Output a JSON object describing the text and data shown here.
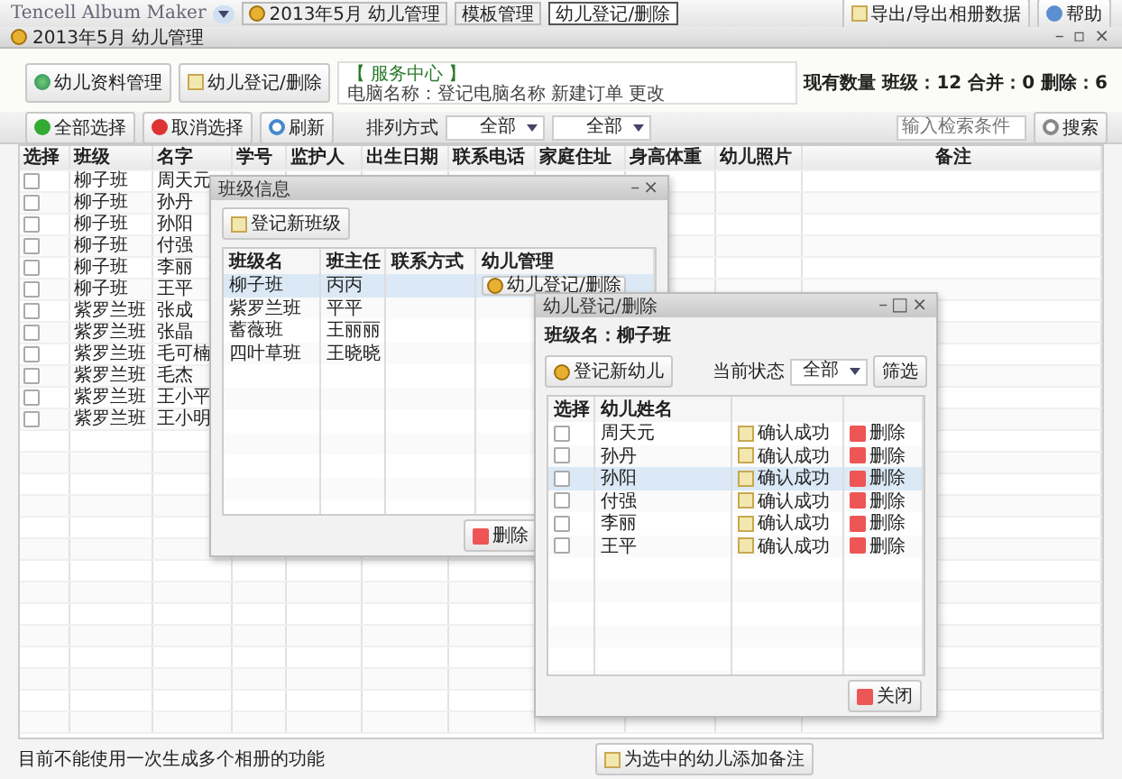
{
  "window": {
    "title": "Tencell Album Maker",
    "tabs": [
      {
        "label": "2013年5月 幼儿管理",
        "selected": false
      },
      {
        "label": "模板管理",
        "selected": false
      },
      {
        "label": "幼儿登记/删除",
        "selected": true
      }
    ],
    "export_button": "导出/导出相册数据",
    "help_button": "帮助",
    "subtitle": "2013年5月 幼儿管理",
    "controls": [
      "–",
      "▫",
      "×"
    ]
  },
  "toolbar": {
    "buttons": [
      "幼儿资料管理",
      "幼儿登记/删除"
    ],
    "info_title": "【 服务中心 】",
    "info_text": "电脑名称：登记电脑名称  新建订单  更改",
    "summary": "现有数量 班级：12 合并：0 删除：6"
  },
  "filter_bar": {
    "buttons": [
      "全部选择",
      "取消选择",
      "刷新"
    ],
    "sort_label": "排列方式",
    "dropdowns": [
      "全部",
      "全部"
    ],
    "search": {
      "placeholder": "输入检索条件"
    },
    "search_button": "搜索"
  },
  "table": {
    "columns": [
      "选择",
      "班级",
      "名字",
      "学号",
      "监护人",
      "出生日期",
      "联系电话",
      "家庭住址",
      "身高体重",
      "幼儿照片",
      "备注"
    ],
    "rows": [
      {
        "checked": false,
        "class": "柳子班",
        "name": "周天元"
      },
      {
        "checked": false,
        "class": "柳子班",
        "name": "孙丹"
      },
      {
        "checked": false,
        "class": "柳子班",
        "name": "孙阳"
      },
      {
        "checked": false,
        "class": "柳子班",
        "name": "付强"
      },
      {
        "checked": false,
        "class": "柳子班",
        "name": "李丽"
      },
      {
        "checked": false,
        "class": "柳子班",
        "name": "王平"
      },
      {
        "checked": false,
        "class": "紫罗兰班",
        "name": "张成"
      },
      {
        "checked": false,
        "class": "紫罗兰班",
        "name": "张晶"
      },
      {
        "checked": false,
        "class": "紫罗兰班",
        "name": "毛可楠"
      },
      {
        "checked": false,
        "class": "紫罗兰班",
        "name": "毛杰"
      },
      {
        "checked": false,
        "class": "紫罗兰班",
        "name": "王小平"
      },
      {
        "checked": false,
        "class": "紫罗兰班",
        "name": "王小明"
      }
    ]
  },
  "class_dialog": {
    "title": "班级信息",
    "controls": [
      "–",
      "×"
    ],
    "add_button": "登记新班级",
    "columns": [
      "班级名",
      "班主任",
      "联系方式",
      "幼儿管理"
    ],
    "rows": [
      {
        "selected": true,
        "name": "柳子班",
        "teacher": "丙丙",
        "action": "幼儿登记/删除"
      },
      {
        "selected": false,
        "name": "紫罗兰班",
        "teacher": "平平"
      },
      {
        "selected": false,
        "name": "蓄薇班",
        "teacher": "王丽丽"
      },
      {
        "selected": false,
        "name": "四叶草班",
        "teacher": "王晓晓"
      }
    ],
    "delete_button": "删除"
  },
  "child_dialog": {
    "title": "幼儿登记/删除",
    "controls": [
      "–",
      "□",
      "×"
    ],
    "class_label": "班级名：柳子班",
    "add_button": "登记新幼儿",
    "status_label": "当前状态",
    "status_value": "全部",
    "filter_button": "筛选",
    "columns": [
      "选择",
      "幼儿姓名"
    ],
    "rows": [
      {
        "checked": false,
        "selected": false,
        "name": "周天元",
        "confirm": "确认成功",
        "delete": "删除"
      },
      {
        "checked": false,
        "selected": false,
        "name": "孙丹",
        "confirm": "确认成功",
        "delete": "删除"
      },
      {
        "checked": false,
        "selected": true,
        "name": "孙阳",
        "confirm": "确认成功",
        "delete": "删除"
      },
      {
        "checked": false,
        "selected": false,
        "name": "付强",
        "confirm": "确认成功",
        "delete": "删除"
      },
      {
        "checked": false,
        "selected": false,
        "name": "李丽",
        "confirm": "确认成功",
        "delete": "删除"
      },
      {
        "checked": false,
        "selected": false,
        "name": "王平",
        "confirm": "确认成功",
        "delete": "删除"
      }
    ],
    "close_button": "关闭"
  },
  "status_bar": {
    "text": "目前不能使用一次生成多个相册的功能",
    "note_button": "为选中的幼儿添加备注"
  }
}
